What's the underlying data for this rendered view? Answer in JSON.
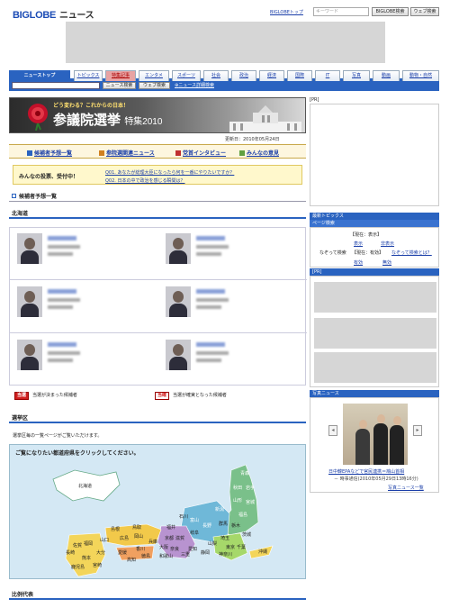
{
  "header": {
    "logo": "BIGLOBE",
    "logo_sub": "ニュース",
    "top_link": "BIGLOBEトップ",
    "keyword_placeholder": "キーワード",
    "search_button": "BIGLOBE検索",
    "web_search_button": "ウェブ検索"
  },
  "tabs": [
    {
      "label": "ニューストップ",
      "active": true
    },
    {
      "label": "トピックス"
    },
    {
      "label": "特集記事",
      "red": true
    },
    {
      "label": "エンタメ"
    },
    {
      "label": "スポーツ"
    },
    {
      "label": "社会"
    },
    {
      "label": "政治"
    },
    {
      "label": "経済"
    },
    {
      "label": "国際"
    },
    {
      "label": "IT"
    },
    {
      "label": "写真"
    },
    {
      "label": "動画"
    },
    {
      "label": "動物・自然"
    }
  ],
  "search": {
    "news_search": "ニュース検索",
    "web_search": "ウェブ検索",
    "advanced": "ニュース詳細検索"
  },
  "banner": {
    "kicker": "どう変わる？これからの日本！",
    "title": "参議院選挙",
    "title_sub": "特集2010"
  },
  "updated": "更新日：2010年05月24日",
  "subnav": [
    "候補者予想一覧",
    "参院選関連ニュース",
    "党首インタビュー",
    "みんなの意見"
  ],
  "poll": {
    "label": "みんなの投票、受付中！",
    "questions": [
      "Q01. あなたが総理大臣になったら何を一番にやりたいですか？",
      "Q02. 日本の中で政治を感じる瞬間は？"
    ]
  },
  "sections": {
    "candidates": "候補者予想一覧",
    "region": "北海道",
    "districts": "選挙区",
    "districts_note": "選挙区毎の一覧ページがご覧いただけます。",
    "proportional": "比例代表"
  },
  "legend": {
    "elected_badge": "当選",
    "elected": "当選が決まった候補者",
    "sure_badge": "当確",
    "sure": "当選が確実となった候補者"
  },
  "map": {
    "prompt": "ご覧になりたい都道府県をクリックしてください。",
    "prefectures": [
      "北海道",
      "青森",
      "秋田",
      "岩手",
      "山形",
      "宮城",
      "福島",
      "新潟",
      "富山",
      "石川",
      "長野",
      "群馬",
      "栃木",
      "茨城",
      "埼玉",
      "千葉",
      "東京",
      "神奈川",
      "山梨",
      "静岡",
      "愛知",
      "岐阜",
      "福井",
      "滋賀",
      "三重",
      "京都",
      "大阪",
      "奈良",
      "兵庫",
      "和歌山",
      "鳥取",
      "岡山",
      "島根",
      "広島",
      "山口",
      "香川",
      "愛媛",
      "徳島",
      "高知",
      "福岡",
      "大分",
      "佐賀",
      "長崎",
      "熊本",
      "宮崎",
      "鹿児島",
      "沖縄"
    ]
  },
  "right": {
    "pr": "[PR]",
    "topics": "最新トピックス",
    "page_rank": "ページ検索",
    "rank_current": "【現在：表示】",
    "rank_show": "表示",
    "rank_hide": "非表示",
    "rank_q": "なぞって検索",
    "rank_now": "【現在：有効】",
    "rank_what": "なぞって検索とは？",
    "rank_on": "有効",
    "rank_off": "無効",
    "pr2": "[PR]",
    "photo_header": "写真ニュース",
    "photo_caption": "日中韓EPAなどで官民連携＝鳩山首相",
    "photo_meta": "－ 時事通信(2010年05月29日13時16分)",
    "photo_more": "写真ニュース一覧"
  }
}
